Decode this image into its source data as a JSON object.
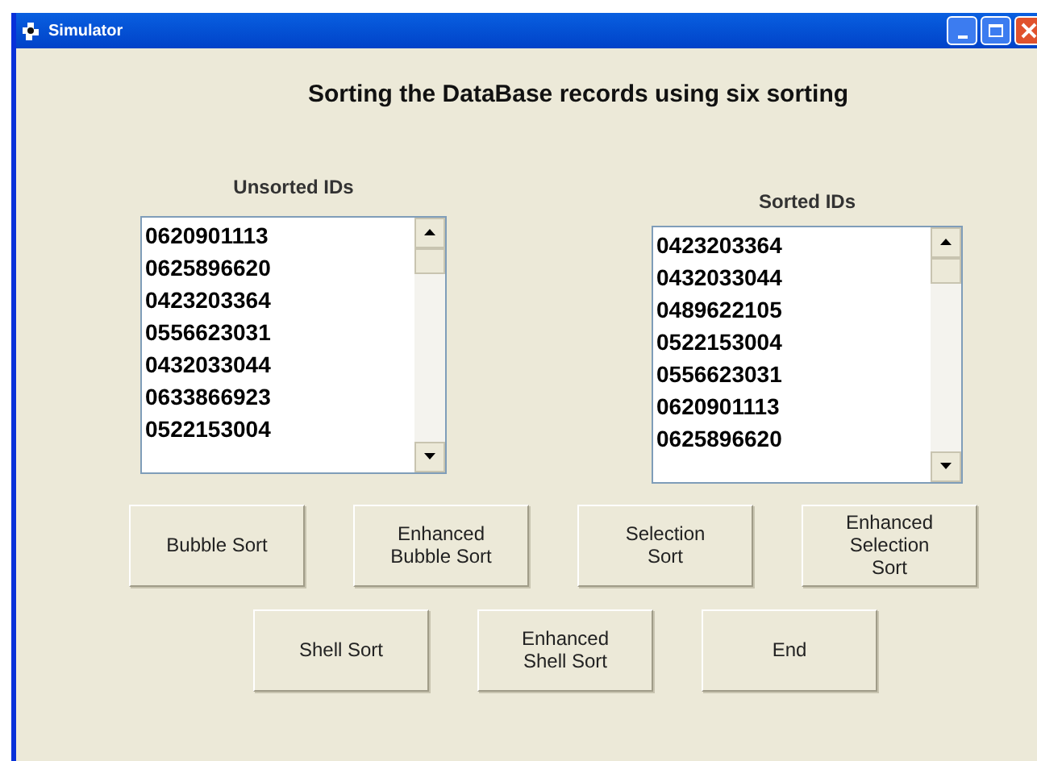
{
  "window": {
    "title": "Simulator"
  },
  "heading": "Sorting the DataBase records using six sorting",
  "lists": [
    {
      "label": "Unsorted IDs",
      "items": [
        "0620901113",
        "0625896620",
        "0423203364",
        "0556623031",
        "0432033044",
        "0633866923",
        "0522153004"
      ]
    },
    {
      "label": "Sorted IDs",
      "items": [
        "0423203364",
        "0432033044",
        "0489622105",
        "0522153004",
        "0556623031",
        "0620901113",
        "0625896620"
      ]
    }
  ],
  "button_rows": [
    [
      "Bubble Sort",
      "Enhanced\nBubble Sort",
      "Selection\nSort",
      "Enhanced\nSelection\nSort"
    ],
    [
      "Shell Sort",
      "Enhanced\nShell Sort",
      "End"
    ]
  ]
}
